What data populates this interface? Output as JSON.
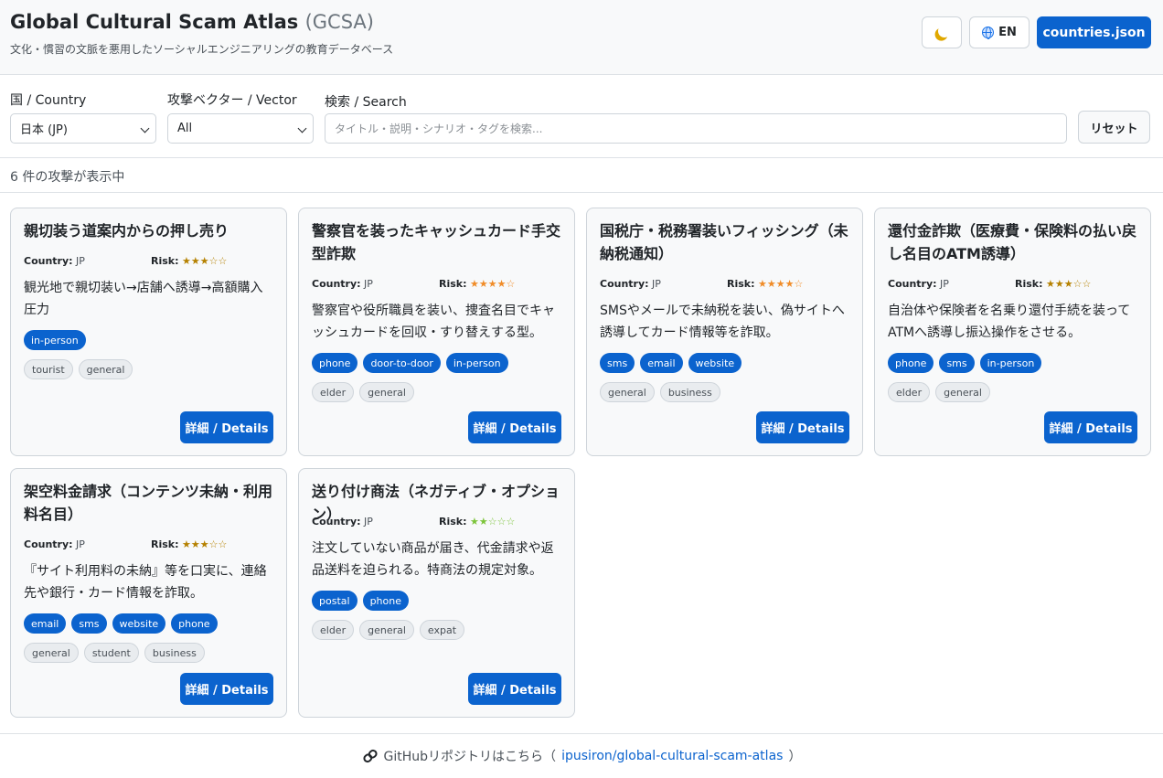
{
  "header": {
    "title": "Global Cultural Scam Atlas",
    "title_abbr": "(GCSA)",
    "subtitle": "文化・慣習の文脈を悪用したソーシャルエンジニアリングの教育データベース",
    "theme_icon": "moon-icon",
    "lang_icon": "globe-icon",
    "lang_label": "EN",
    "json_button": "countries.json"
  },
  "filters": {
    "country_label": "国 / Country",
    "country_value": "日本 (JP)",
    "vector_label": "攻撃ベクター / Vector",
    "vector_value": "All",
    "search_label": "検索 / Search",
    "search_placeholder": "タイトル・説明・シナリオ・タグを検索...",
    "reset_label": "リセット"
  },
  "result_count": "6 件の攻撃が表示中",
  "card_labels": {
    "country": "Country:",
    "risk": "Risk:",
    "details": "詳細 / Details"
  },
  "cards": [
    {
      "title": "親切装う道案内からの押し売り",
      "country": "JP",
      "risk": 3,
      "stars": "★★★☆☆",
      "description": "観光地で親切装い→店舗へ誘導→高額購入圧力",
      "vectors": [
        "in-person"
      ],
      "tags": [
        "tourist",
        "general"
      ]
    },
    {
      "title": "警察官を装ったキャッシュカード手交型詐欺",
      "country": "JP",
      "risk": 4,
      "stars": "★★★★☆",
      "description": "警察官や役所職員を装い、捜査名目でキャッシュカードを回収・すり替えする型。",
      "vectors": [
        "phone",
        "door-to-door",
        "in-person"
      ],
      "tags": [
        "elder",
        "general"
      ]
    },
    {
      "title": "国税庁・税務署装いフィッシング（未納税通知）",
      "country": "JP",
      "risk": 4,
      "stars": "★★★★☆",
      "description": "SMSやメールで未納税を装い、偽サイトへ誘導してカード情報等を詐取。",
      "vectors": [
        "sms",
        "email",
        "website"
      ],
      "tags": [
        "general",
        "business"
      ]
    },
    {
      "title": "還付金詐欺（医療費・保険料の払い戻し名目のATM誘導）",
      "country": "JP",
      "risk": 3,
      "stars": "★★★☆☆",
      "description": "自治体や保険者を名乗り還付手続を装ってATMへ誘導し振込操作をさせる。",
      "vectors": [
        "phone",
        "sms",
        "in-person"
      ],
      "tags": [
        "elder",
        "general"
      ]
    },
    {
      "title": "架空料金請求（コンテンツ未納・利用料名目）",
      "country": "JP",
      "risk": 3,
      "stars": "★★★☆☆",
      "description": "『サイト利用料の未納』等を口実に、連絡先や銀行・カード情報を詐取。",
      "vectors": [
        "email",
        "sms",
        "website",
        "phone"
      ],
      "tags": [
        "general",
        "student",
        "business"
      ]
    },
    {
      "title": "送り付け商法（ネガティブ・オプション）",
      "country": "JP",
      "risk": 2,
      "stars": "★★☆☆☆",
      "description": "注文していない商品が届き、代金請求や返品送料を迫られる。特商法の規定対象。",
      "vectors": [
        "postal",
        "phone"
      ],
      "tags": [
        "elder",
        "general",
        "expat"
      ]
    }
  ],
  "colors": {
    "accent": "#0b63ce",
    "risk3": "#b58100",
    "risk4": "#f08c28",
    "risk2": "#7cc43a"
  },
  "footer": {
    "icon": "link-icon",
    "text": "GitHubリポジトリはこちら（",
    "link": "ipusiron/global-cultural-scam-atlas",
    "close": "）"
  }
}
